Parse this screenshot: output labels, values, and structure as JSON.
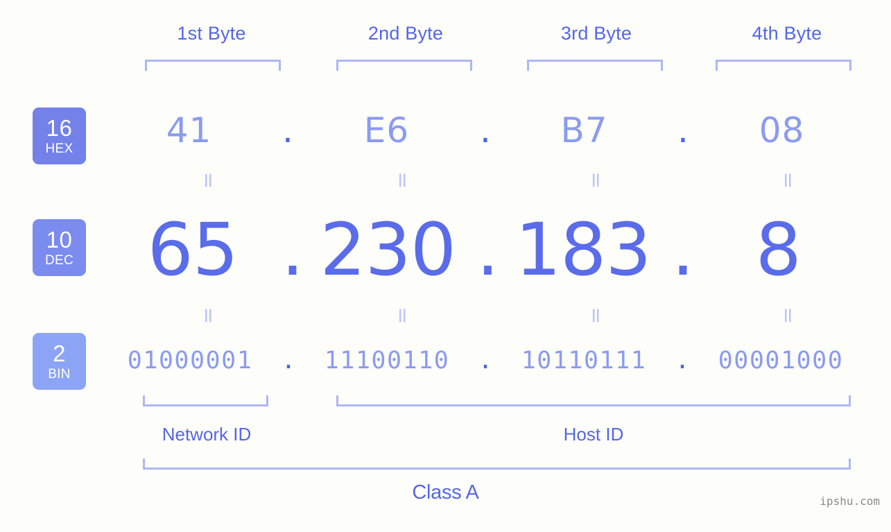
{
  "background_color": "#fdfdfa",
  "accent_color": "#5566e8",
  "bracket_color": "#adb7f5",
  "byte_headers": [
    {
      "label": "1st Byte"
    },
    {
      "label": "2nd Byte"
    },
    {
      "label": "3rd Byte"
    },
    {
      "label": "4th Byte"
    }
  ],
  "bases": {
    "hex": {
      "number": "16",
      "name": "HEX",
      "color": "#7381e8"
    },
    "dec": {
      "number": "10",
      "name": "DEC",
      "color": "#7b8bee"
    },
    "bin": {
      "number": "2",
      "name": "BIN",
      "color": "#8ca4f5"
    }
  },
  "rows": {
    "hex": {
      "values": [
        "41",
        "E6",
        "B7",
        "08"
      ],
      "separator": "."
    },
    "dec": {
      "values": [
        "65",
        "230",
        "183",
        "8"
      ],
      "separator": "."
    },
    "bin": {
      "values": [
        "01000001",
        "11100110",
        "10110111",
        "00001000"
      ],
      "separator": "."
    }
  },
  "equals_symbol": "=",
  "segments": {
    "network_id": "Network ID",
    "host_id": "Host ID"
  },
  "class_label": "Class A",
  "watermark": "ipshu.com"
}
